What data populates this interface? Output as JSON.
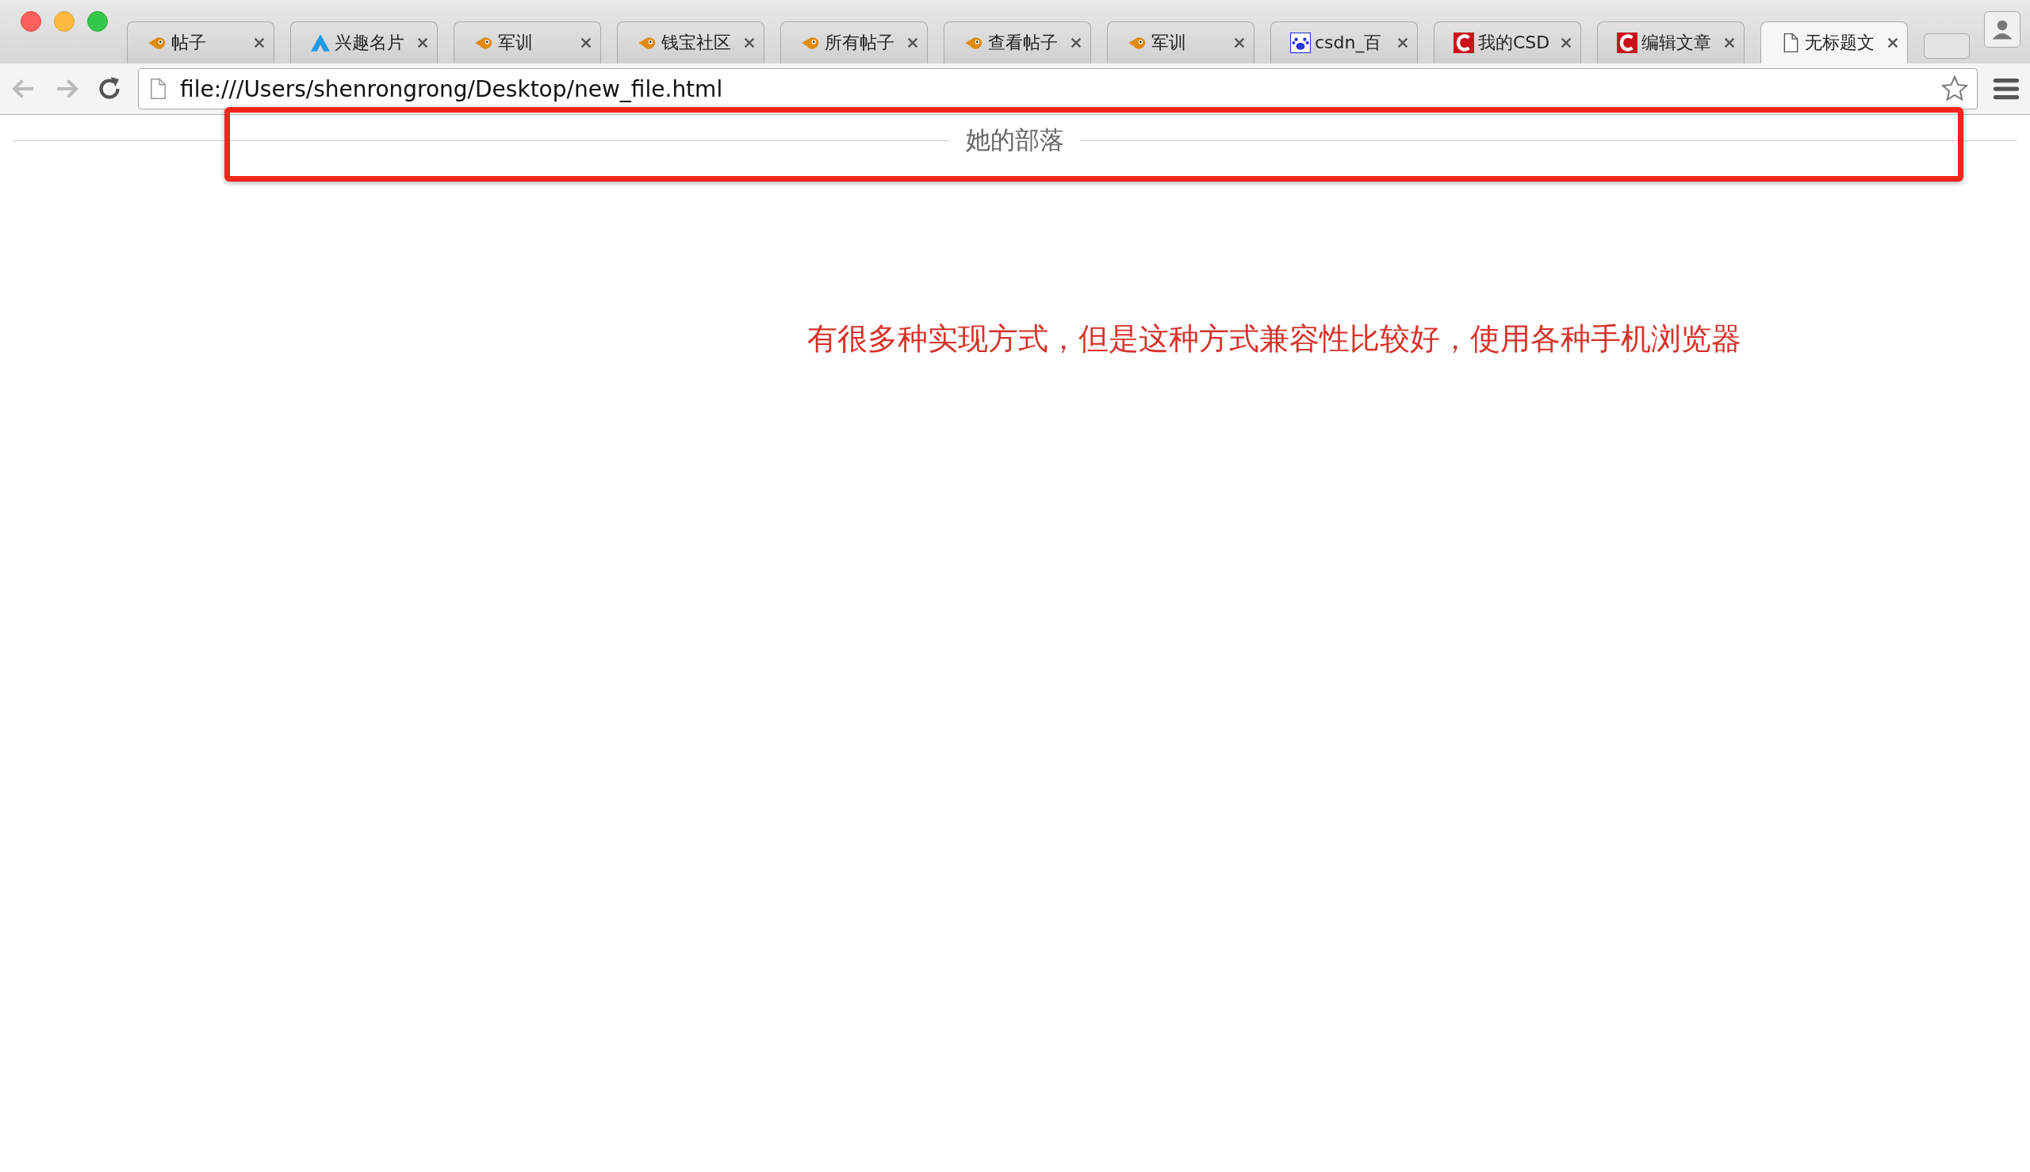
{
  "tabs": [
    {
      "kind": "bird",
      "title": "帖子",
      "selected": false
    },
    {
      "kind": "triangle",
      "title": "兴趣名片",
      "selected": false
    },
    {
      "kind": "bird",
      "title": "军训",
      "selected": false
    },
    {
      "kind": "bird",
      "title": "钱宝社区",
      "selected": false
    },
    {
      "kind": "bird",
      "title": "所有帖子",
      "selected": false
    },
    {
      "kind": "bird",
      "title": "查看帖子",
      "selected": false
    },
    {
      "kind": "bird",
      "title": "军训",
      "selected": false
    },
    {
      "kind": "paw",
      "title": "csdn_百",
      "selected": false
    },
    {
      "kind": "csdn",
      "title": "我的CSD",
      "selected": false
    },
    {
      "kind": "csdn",
      "title": "编辑文章",
      "selected": false
    },
    {
      "kind": "page",
      "title": "无标题文",
      "selected": true
    }
  ],
  "address_bar": {
    "value": "file:///Users/shenrongrong/Desktop/new_file.html"
  },
  "page": {
    "heading": "她的部落",
    "note": "有很多种实现方式，但是这种方式兼容性比较好，使用各种手机浏览器"
  }
}
